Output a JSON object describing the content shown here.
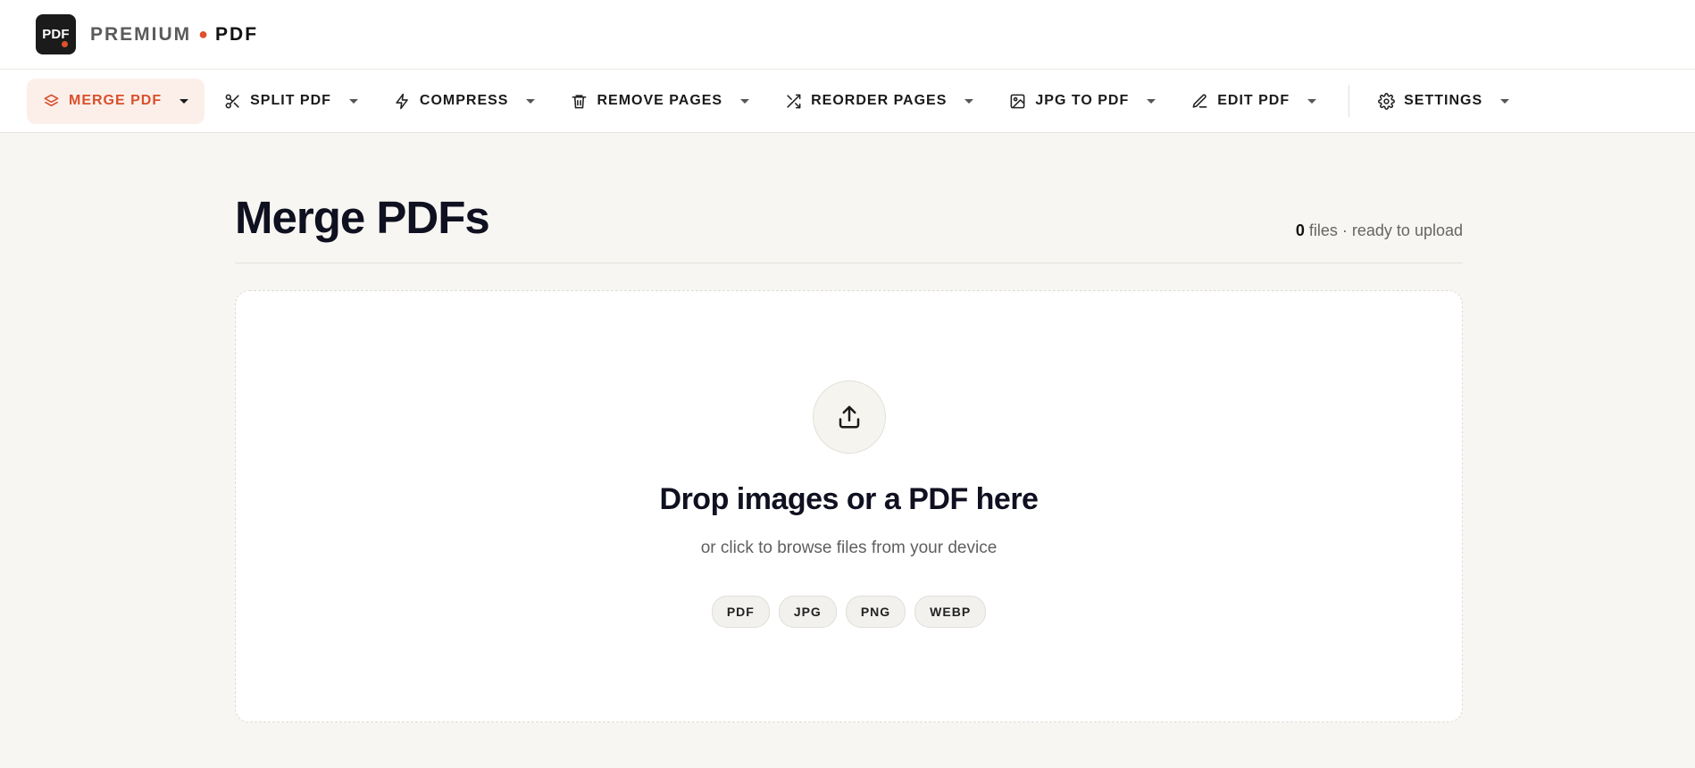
{
  "brand": {
    "logo_text": "PDF",
    "name_part1": "PREMIUM",
    "separator": "●",
    "name_part2": "PDF",
    "accent_color": "#e0502b"
  },
  "nav": {
    "items": [
      {
        "label": "MERGE PDF",
        "icon": "layers-icon",
        "active": true
      },
      {
        "label": "SPLIT PDF",
        "icon": "scissors-icon"
      },
      {
        "label": "COMPRESS",
        "icon": "lightning-icon"
      },
      {
        "label": "REMOVE PAGES",
        "icon": "trash-icon"
      },
      {
        "label": "REORDER PAGES",
        "icon": "shuffle-icon"
      },
      {
        "label": "JPG TO PDF",
        "icon": "image-icon"
      },
      {
        "label": "EDIT PDF",
        "icon": "pen-icon"
      },
      {
        "label": "SETTINGS",
        "icon": "gear-icon"
      }
    ]
  },
  "main": {
    "title": "Merge PDFs",
    "file_count": "0",
    "file_status": " files · ready to upload"
  },
  "dropzone": {
    "icon": "upload-icon",
    "title": "Drop images or a PDF here",
    "subtitle": "or click to browse files from your device",
    "formats": [
      "PDF",
      "JPG",
      "PNG",
      "WEBP"
    ]
  }
}
